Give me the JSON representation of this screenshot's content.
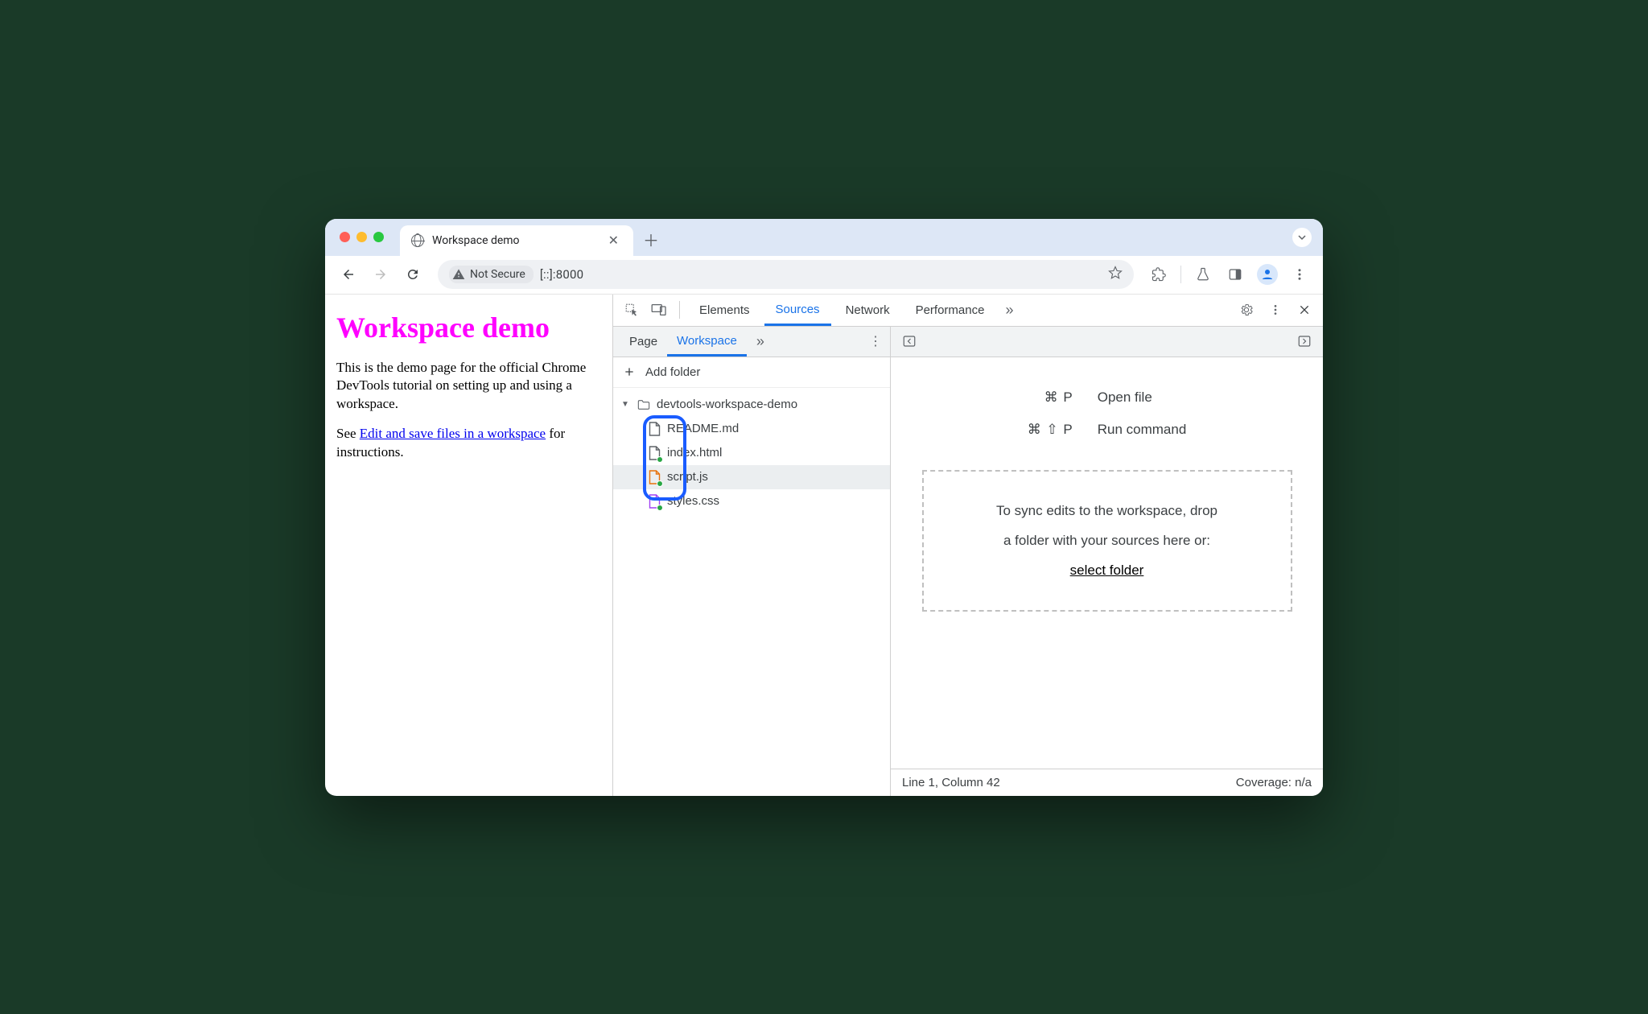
{
  "browser": {
    "tab_title": "Workspace demo",
    "not_secure": "Not Secure",
    "url": "[::]:8000"
  },
  "page": {
    "h1": "Workspace demo",
    "p1": "This is the demo page for the official Chrome DevTools tutorial on setting up and using a workspace.",
    "p2a": "See ",
    "p2_link": "Edit and save files in a workspace",
    "p2b": " for instructions."
  },
  "devtools": {
    "tabs": {
      "elements": "Elements",
      "sources": "Sources",
      "network": "Network",
      "performance": "Performance"
    },
    "sources_subtabs": {
      "page": "Page",
      "workspace": "Workspace"
    },
    "add_folder": "Add folder",
    "folder": "devtools-workspace-demo",
    "files": {
      "readme": "README.md",
      "index": "index.html",
      "script": "script.js",
      "styles": "styles.css"
    },
    "shortcuts": {
      "open_k": "⌘ P",
      "open_l": "Open file",
      "run_k": "⌘ ⇧ P",
      "run_l": "Run command"
    },
    "drop": {
      "line1": "To sync edits to the workspace, drop",
      "line2": "a folder with your sources here or:",
      "link": "select folder"
    },
    "status": {
      "pos": "Line 1, Column 42",
      "cov": "Coverage: n/a"
    }
  }
}
